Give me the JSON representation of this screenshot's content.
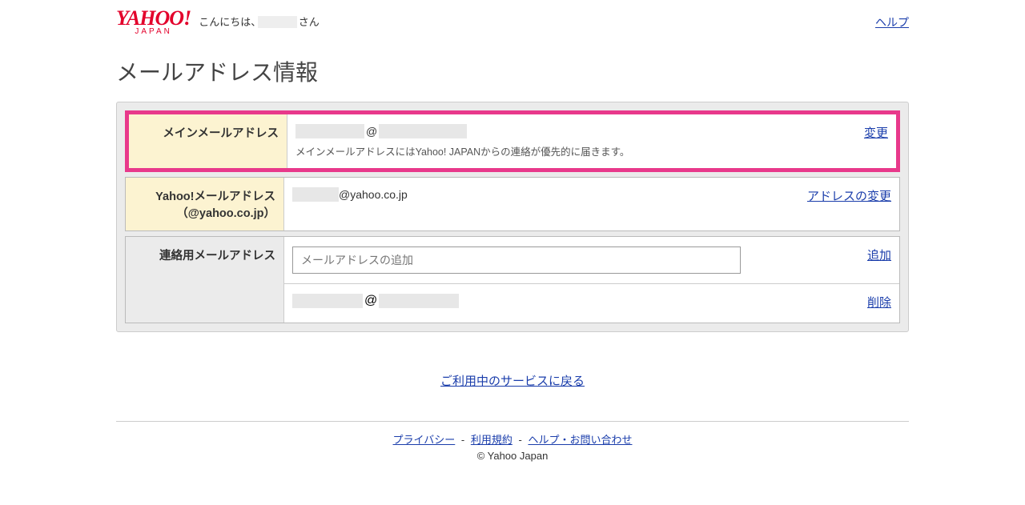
{
  "header": {
    "logo_main": "YAHOO!",
    "logo_sub": "JAPAN",
    "greeting_prefix": "こんにちは、",
    "greeting_suffix": "さん",
    "help_label": "ヘルプ"
  },
  "page_title": "メールアドレス情報",
  "main_email": {
    "label": "メインメールアドレス",
    "at": "@",
    "note": "メインメールアドレスにはYahoo! JAPANからの連絡が優先的に届きます。",
    "action": "変更"
  },
  "yahoo_email": {
    "label_line1": "Yahoo!メールアドレス",
    "label_line2": "（@yahoo.co.jp）",
    "domain": "@yahoo.co.jp",
    "action": "アドレスの変更"
  },
  "contact_email": {
    "label": "連絡用メールアドレス",
    "placeholder": "メールアドレスの追加",
    "add_action": "追加",
    "at": "@",
    "delete_action": "削除"
  },
  "back_link": "ご利用中のサービスに戻る",
  "footer": {
    "privacy": "プライバシー",
    "terms": "利用規約",
    "help": "ヘルプ・お問い合わせ",
    "sep": "-",
    "copyright": "© Yahoo Japan"
  }
}
